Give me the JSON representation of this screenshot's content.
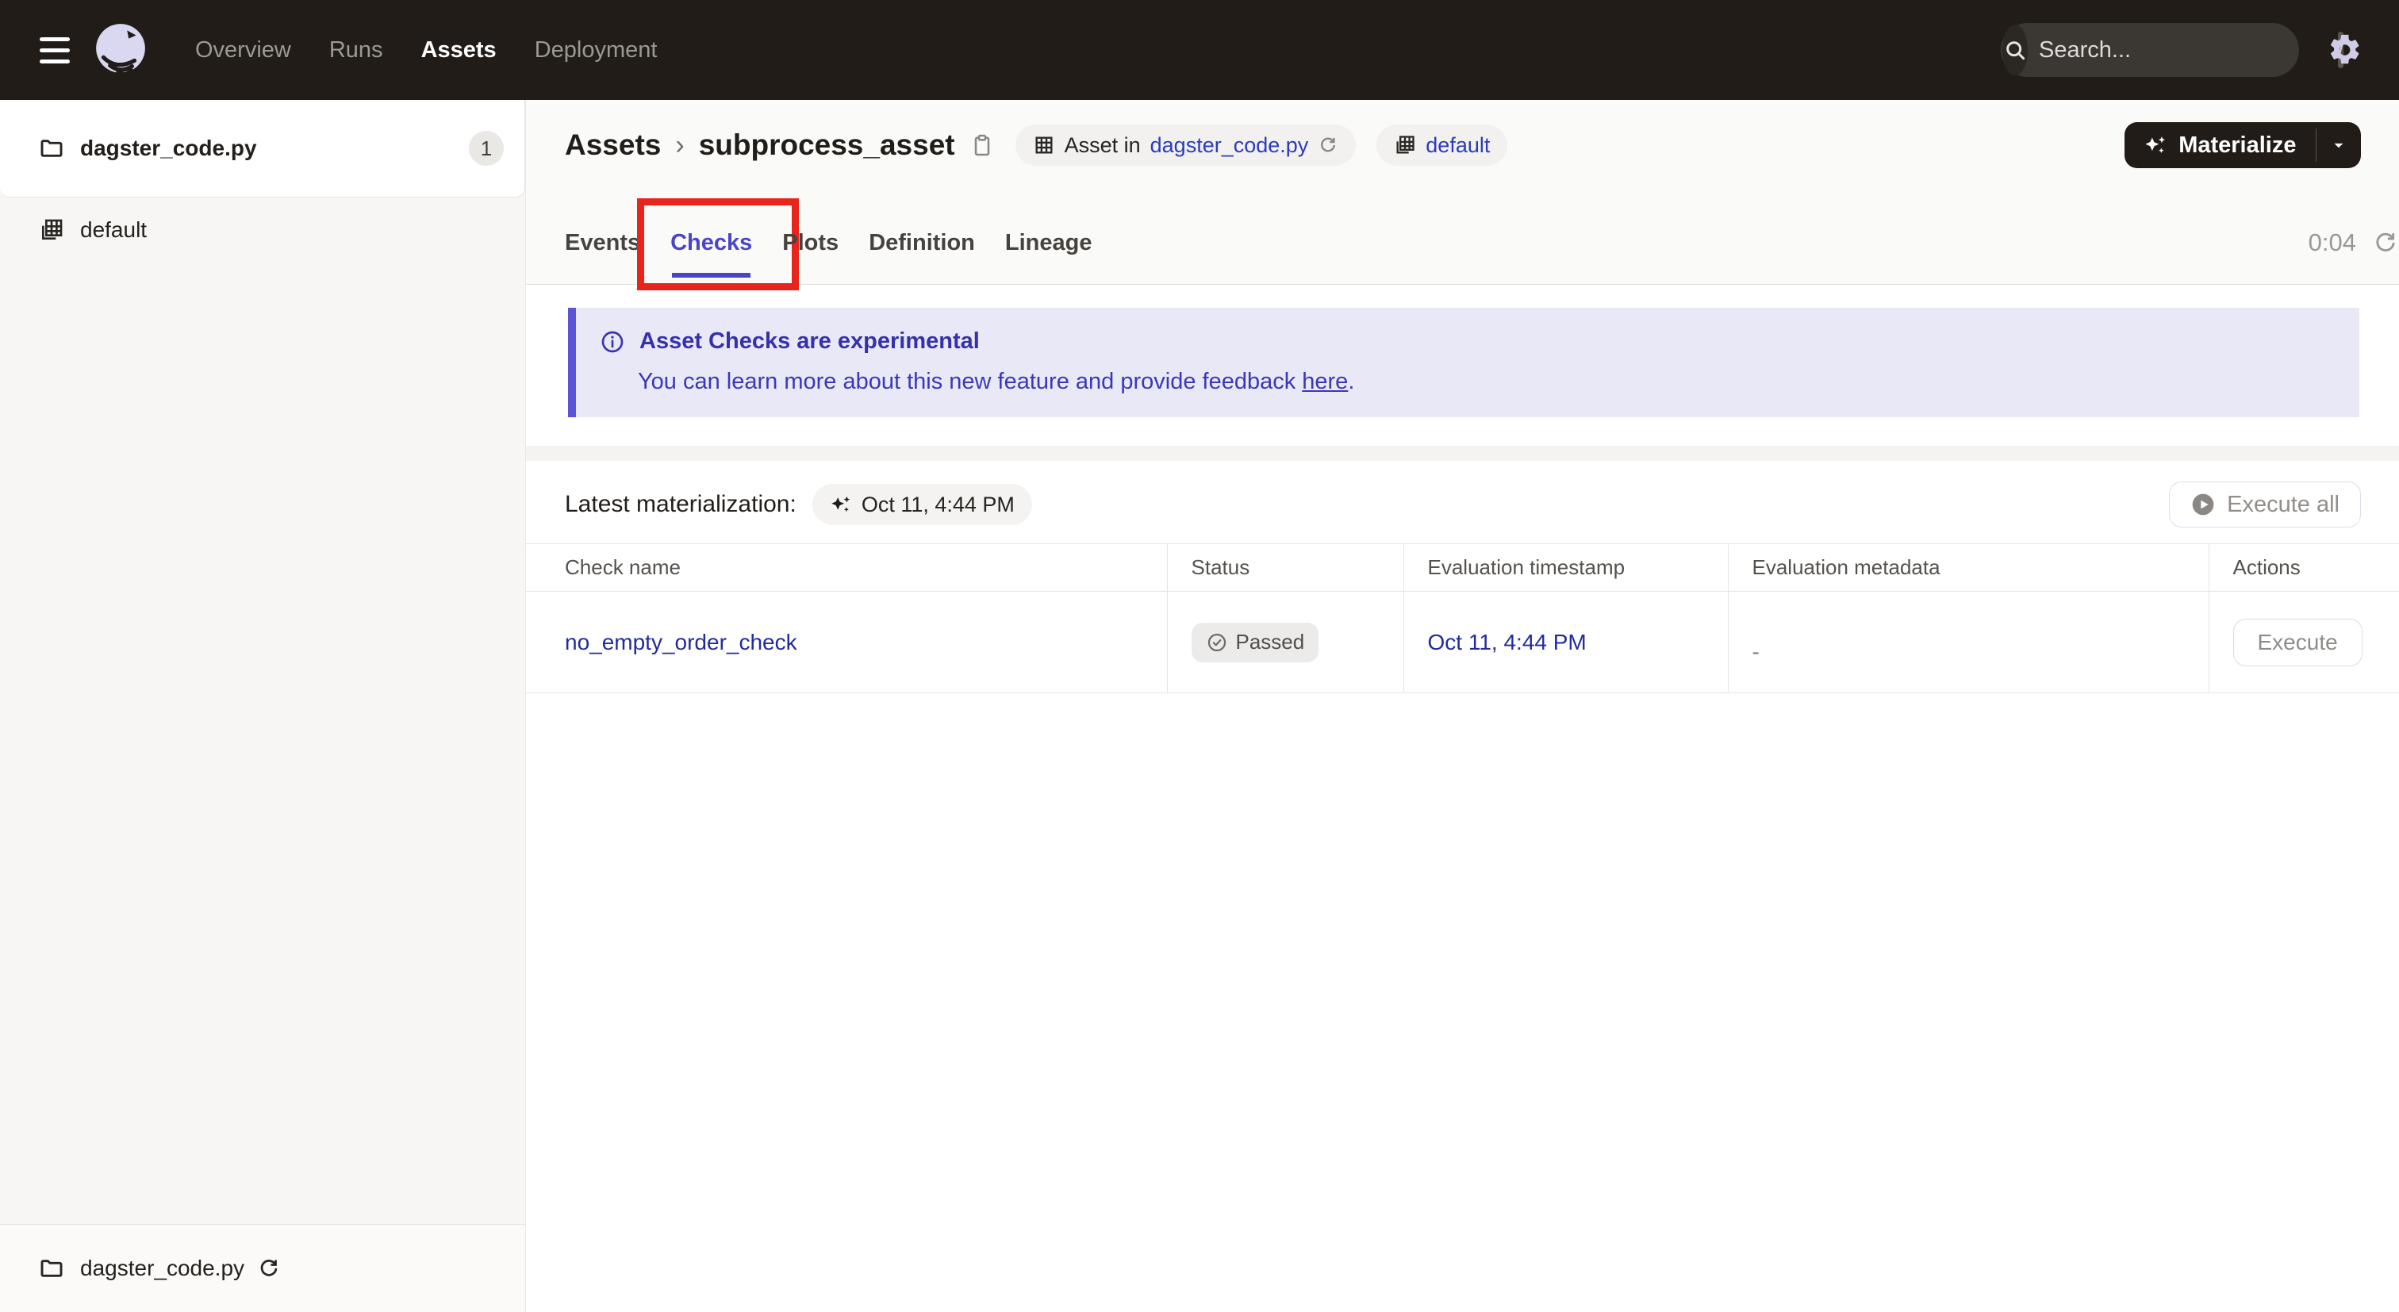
{
  "nav": {
    "items": [
      {
        "label": "Overview",
        "active": false
      },
      {
        "label": "Runs",
        "active": false
      },
      {
        "label": "Assets",
        "active": true
      },
      {
        "label": "Deployment",
        "active": false
      }
    ],
    "search": {
      "placeholder": "Search...",
      "shortcut": "/"
    }
  },
  "sidebar": {
    "top_card": {
      "label": "dagster_code.py",
      "badge": "1"
    },
    "group_item": {
      "label": "default"
    },
    "bottom_item": {
      "label": "dagster_code.py"
    }
  },
  "header": {
    "breadcrumb": {
      "root": "Assets",
      "separator": "›",
      "current": "subprocess_asset"
    },
    "asset_chip": {
      "prefix": "Asset in",
      "link": "dagster_code.py"
    },
    "group_chip": {
      "link": "default"
    },
    "materialize_label": "Materialize"
  },
  "tabs": {
    "items": [
      {
        "label": "Events"
      },
      {
        "label": "Checks"
      },
      {
        "label": "Plots"
      },
      {
        "label": "Definition"
      },
      {
        "label": "Lineage"
      }
    ],
    "active": "Checks",
    "timer": "0:04"
  },
  "banner": {
    "title": "Asset Checks are experimental",
    "body": "You can learn more about this new feature and provide feedback ",
    "link_text": "here",
    "suffix": "."
  },
  "materialization": {
    "label": "Latest materialization:",
    "value": "Oct 11, 4:44 PM"
  },
  "buttons": {
    "execute_all": "Execute all",
    "execute": "Execute"
  },
  "table": {
    "columns": [
      "Check name",
      "Status",
      "Evaluation timestamp",
      "Evaluation metadata",
      "Actions"
    ],
    "rows": [
      {
        "check_name": "no_empty_order_check",
        "status": "Passed",
        "evaluation_timestamp": "Oct 11, 4:44 PM",
        "evaluation_metadata": "-"
      }
    ]
  },
  "colors": {
    "nav_bg": "#211C18",
    "accent_indigo": "#4B45C6",
    "banner_bg": "#E9E8F6",
    "banner_text": "#3531AC",
    "chip_link_blue": "#2B3BBC",
    "table_link_navy": "#222B9D",
    "annotation_red": "#E8241C"
  }
}
